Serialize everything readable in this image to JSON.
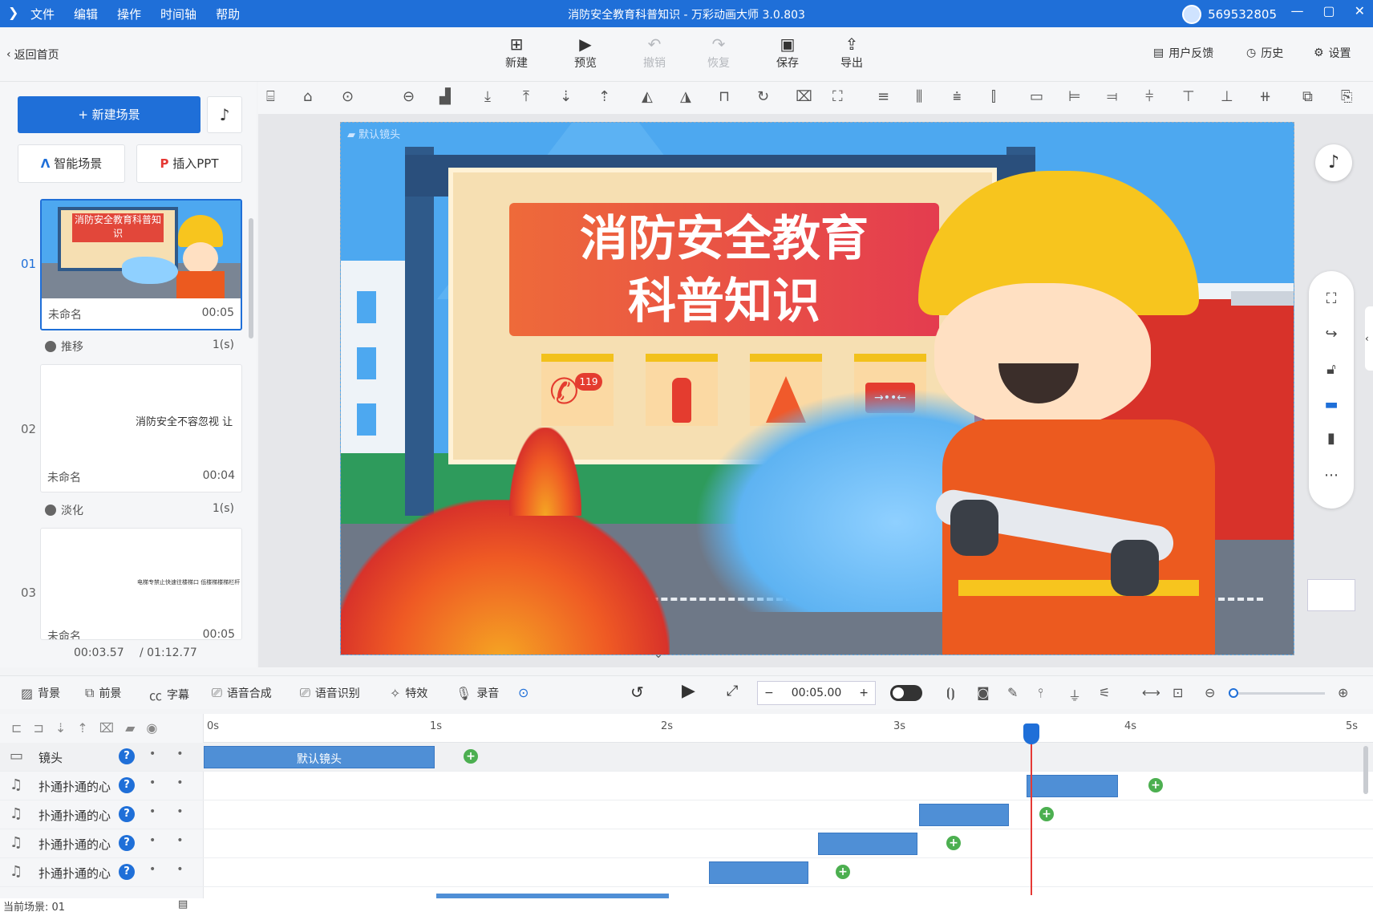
{
  "window": {
    "menu": [
      "文件",
      "编辑",
      "操作",
      "时间轴",
      "帮助"
    ],
    "title": "消防安全教育科普知识 - 万彩动画大师 3.0.803",
    "user_id": "569532805"
  },
  "toolbar": {
    "back_label": "返回首页",
    "new_label": "新建",
    "preview_label": "预览",
    "undo_label": "撤销",
    "redo_label": "恢复",
    "save_label": "保存",
    "export_label": "导出",
    "feedback_label": "用户反馈",
    "history_label": "历史",
    "settings_label": "设置"
  },
  "scenes_panel": {
    "new_scene_label": "+ 新建场景",
    "smart_scene_label": "智能场景",
    "insert_ppt_label": "插入PPT",
    "scenes": [
      {
        "num": "01",
        "name": "未命名",
        "duration": "00:05",
        "thumb_title": "消防安全教育科普知识"
      },
      {
        "num": "02",
        "name": "未命名",
        "duration": "00:04",
        "thumb_text": "消防安全不容忽视 让"
      },
      {
        "num": "03",
        "name": "未命名",
        "duration": "00:05",
        "thumb_text": "电梯专禁止快速往楼梯口 低楼梯楼梯栏杆"
      }
    ],
    "transitions": [
      {
        "name": "推移",
        "duration": "1(s)"
      },
      {
        "name": "淡化",
        "duration": "1(s)"
      }
    ],
    "current_time": "00:03.57",
    "total_time": "/ 01:12.77"
  },
  "stage": {
    "camera_label": "默认镜头",
    "title_line1": "消防安全教育",
    "title_line2": "科普知识",
    "phone_number": "119"
  },
  "controls": {
    "background_label": "背景",
    "foreground_label": "前景",
    "subtitle_label": "字幕",
    "tts_label": "语音合成",
    "asr_label": "语音识别",
    "effects_label": "特效",
    "record_label": "录音",
    "scene_duration": "00:05.00"
  },
  "timeline": {
    "ruler": [
      "0s",
      "1s",
      "2s",
      "3s",
      "4s",
      "5s"
    ],
    "tracks": [
      {
        "name": "镜头",
        "clip_label": "默认镜头"
      },
      {
        "name": "扑通扑通的心"
      },
      {
        "name": "扑通扑通的心"
      },
      {
        "name": "扑通扑通的心"
      },
      {
        "name": "扑通扑通的心"
      }
    ],
    "status": "当前场景: 01"
  }
}
